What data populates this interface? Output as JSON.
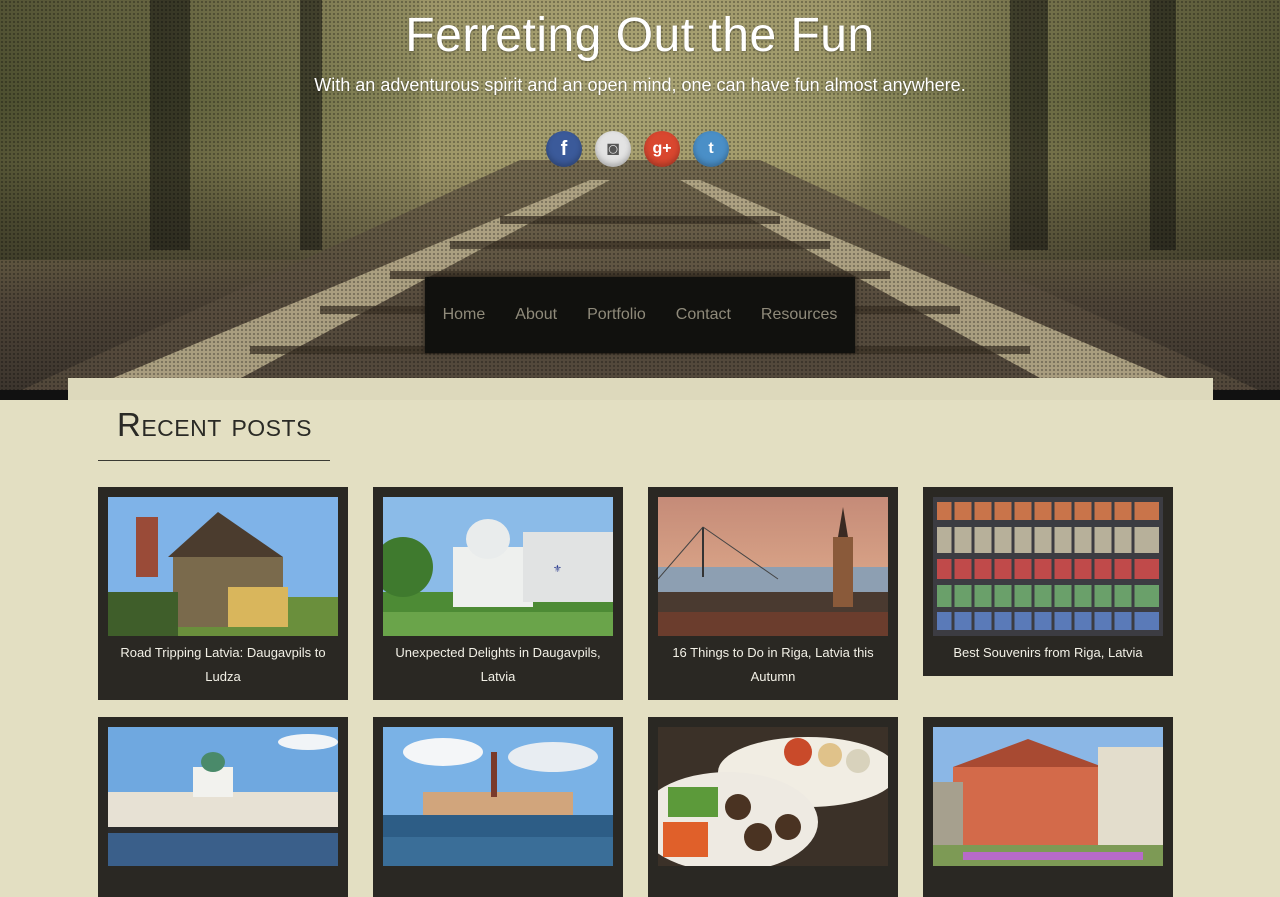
{
  "site": {
    "title": "Ferreting Out the Fun",
    "tagline": "With an adventurous spirit and an open mind, one can have fun almost anywhere."
  },
  "social": [
    {
      "name": "facebook-icon",
      "glyph": "f",
      "color": "#3b5a9a"
    },
    {
      "name": "instagram-icon",
      "glyph": "◙",
      "color": "#e3e3e3"
    },
    {
      "name": "google-plus-icon",
      "glyph": "g+",
      "color": "#d9472f"
    },
    {
      "name": "twitter-icon",
      "glyph": "t",
      "color": "#4a8fc7"
    }
  ],
  "nav": {
    "items": [
      "Home",
      "About",
      "Portfolio",
      "Contact",
      "Resources"
    ]
  },
  "recent": {
    "heading": "Recent posts",
    "posts": [
      {
        "title": "Road Tripping Latvia: Daugavpils to Ludza"
      },
      {
        "title": "Unexpected Delights in Daugavpils, Latvia"
      },
      {
        "title": "16 Things to Do in Riga, Latvia this Autumn"
      },
      {
        "title": "Best Souvenirs from Riga, Latvia"
      },
      {
        "title": ""
      },
      {
        "title": ""
      },
      {
        "title": ""
      },
      {
        "title": ""
      }
    ]
  }
}
